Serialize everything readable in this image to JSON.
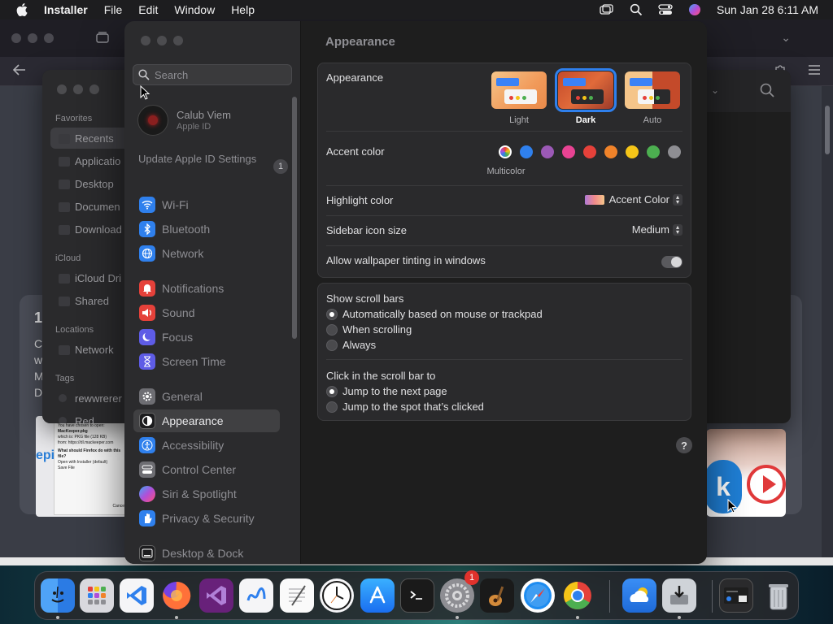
{
  "menubar": {
    "app_name": "Installer",
    "items": [
      "File",
      "Edit",
      "Window",
      "Help"
    ],
    "datetime": "Sun Jan 28  6:11 AM"
  },
  "finder": {
    "favorites_heading": "Favorites",
    "favorites": [
      "Recents",
      "Applicatio",
      "Desktop",
      "Documen",
      "Download"
    ],
    "icloud_heading": "iCloud",
    "icloud_items": [
      "iCloud Dri",
      "Shared"
    ],
    "locations_heading": "Locations",
    "locations": [
      "Network"
    ],
    "tags_heading": "Tags",
    "tags": [
      "rewwrerer",
      "Red"
    ]
  },
  "background": {
    "card_title": "1",
    "card_lines": [
      "C",
      "w",
      "M",
      "D"
    ],
    "dialog_lines": [
      "You have chosen to open:",
      "MacKeeper.pkg",
      "which is: PKG file (128 KB)",
      "from: https://dl.mackeeper.com",
      "What should Firefox do with this file?",
      "Open with  Installer (default)",
      "Save File"
    ],
    "dialog_cancel": "Cance",
    "left_peek_text": "epi"
  },
  "settings": {
    "search_placeholder": "Search",
    "profile": {
      "name": "Calub Viem",
      "subtitle": "Apple ID"
    },
    "update": {
      "label": "Update Apple ID Settings",
      "count": "1"
    },
    "nav": [
      {
        "label": "Wi-Fi",
        "icon": "wifi-icon",
        "color": "#2f80ed"
      },
      {
        "label": "Bluetooth",
        "icon": "bluetooth-icon",
        "color": "#2f80ed"
      },
      {
        "label": "Network",
        "icon": "globe-icon",
        "color": "#2f80ed"
      },
      {
        "label": "Notifications",
        "icon": "bell-icon",
        "color": "#e5413a"
      },
      {
        "label": "Sound",
        "icon": "speaker-icon",
        "color": "#e5413a"
      },
      {
        "label": "Focus",
        "icon": "moon-icon",
        "color": "#5e5ce6"
      },
      {
        "label": "Screen Time",
        "icon": "hourglass-icon",
        "color": "#5e5ce6"
      },
      {
        "label": "General",
        "icon": "gear-icon",
        "color": "#8e8e93"
      },
      {
        "label": "Appearance",
        "icon": "appearance-icon",
        "color": "#1c1c1e"
      },
      {
        "label": "Accessibility",
        "icon": "accessibility-icon",
        "color": "#2f80ed"
      },
      {
        "label": "Control Center",
        "icon": "control-center-icon",
        "color": "#8e8e93"
      },
      {
        "label": "Siri & Spotlight",
        "icon": "siri-icon",
        "color": "#b04fd8"
      },
      {
        "label": "Privacy & Security",
        "icon": "hand-icon",
        "color": "#2f80ed"
      },
      {
        "label": "Desktop & Dock",
        "icon": "dock-icon",
        "color": "#1c1c1e"
      }
    ],
    "active_nav": "Appearance",
    "main_title": "Appearance",
    "appearance": {
      "label": "Appearance",
      "options": [
        "Light",
        "Dark",
        "Auto"
      ],
      "selected": "Dark"
    },
    "accent": {
      "label": "Accent color",
      "multicolor_label": "Multicolor",
      "colors": [
        "#2f80ed",
        "#9b59b6",
        "#e84393",
        "#e5413a",
        "#f0832a",
        "#f5c518",
        "#4caf50",
        "#8e8e93"
      ]
    },
    "highlight": {
      "label": "Highlight color",
      "value": "Accent Color"
    },
    "sidebar_icon_size": {
      "label": "Sidebar icon size",
      "value": "Medium"
    },
    "wallpaper_tinting": {
      "label": "Allow wallpaper tinting in windows",
      "on": false
    },
    "scroll_bars": {
      "label": "Show scroll bars",
      "options": [
        "Automatically based on mouse or trackpad",
        "When scrolling",
        "Always"
      ],
      "selected": 0
    },
    "click_scroll": {
      "label": "Click in the scroll bar to",
      "options": [
        "Jump to the next page",
        "Jump to the spot that’s clicked"
      ],
      "selected": 0
    },
    "help": "?"
  },
  "dock": {
    "apps": [
      "Finder",
      "Launchpad",
      "Visual Studio Code",
      "Firefox",
      "Visual Studio",
      "Freeform",
      "TextEdit",
      "Clock",
      "App Store",
      "Terminal",
      "System Settings",
      "GarageBand",
      "Safari",
      "Chrome",
      "Weather",
      "Installer",
      "Downloads",
      "Trash"
    ],
    "settings_badge": "1"
  }
}
